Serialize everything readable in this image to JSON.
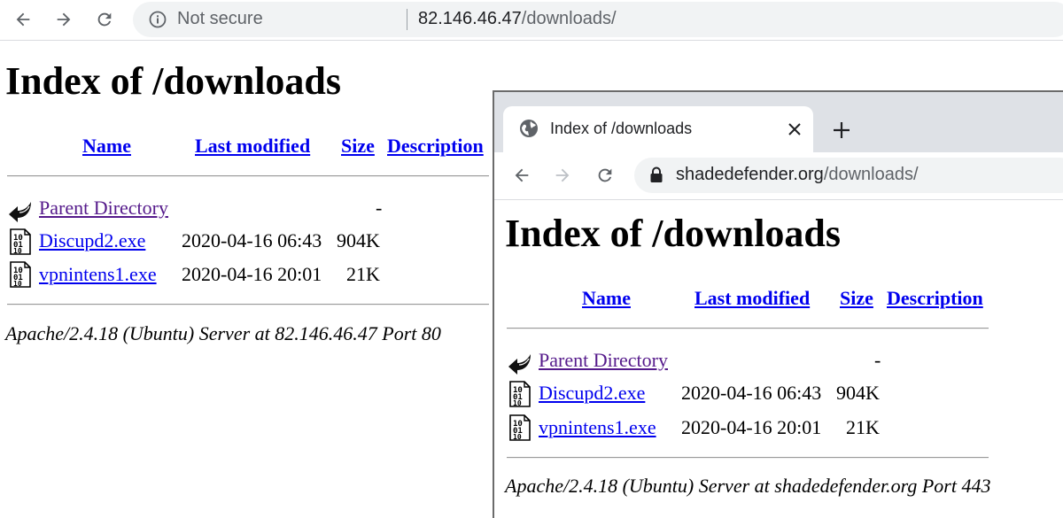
{
  "back_window": {
    "omnibox": {
      "security_text": "Not secure",
      "url_host": "82.146.46.47",
      "url_path": "/downloads/"
    },
    "page": {
      "heading": "Index of /downloads",
      "columns": {
        "name": "Name",
        "last_modified": "Last modified",
        "size": "Size",
        "description": "Description"
      },
      "parent": {
        "name": "Parent Directory",
        "size": "-"
      },
      "rows": [
        {
          "name": "Discupd2.exe",
          "modified": "2020-04-16 06:43",
          "size": "904K"
        },
        {
          "name": "vpnintens1.exe",
          "modified": "2020-04-16 20:01",
          "size": "21K"
        }
      ],
      "address": "Apache/2.4.18 (Ubuntu) Server at 82.146.46.47 Port 80"
    }
  },
  "front_window": {
    "tab": {
      "title": "Index of /downloads",
      "close_icon": "close-icon",
      "new_tab_icon": "plus-icon"
    },
    "omnibox": {
      "url_host": "shadedefender.org",
      "url_path": "/downloads/"
    },
    "page": {
      "heading": "Index of /downloads",
      "columns": {
        "name": "Name",
        "last_modified": "Last modified",
        "size": "Size",
        "description": "Description"
      },
      "parent": {
        "name": "Parent Directory",
        "size": "-"
      },
      "rows": [
        {
          "name": "Discupd2.exe",
          "modified": "2020-04-16 06:43",
          "size": "904K"
        },
        {
          "name": "vpnintens1.exe",
          "modified": "2020-04-16 20:01",
          "size": "21K"
        }
      ],
      "address": "Apache/2.4.18 (Ubuntu) Server at shadedefender.org Port 443"
    }
  },
  "colors": {
    "link": "#0000ee",
    "visited": "#551a8b",
    "omnibox_bg": "#f1f3f4",
    "tabstrip_bg": "#dee1e6"
  }
}
